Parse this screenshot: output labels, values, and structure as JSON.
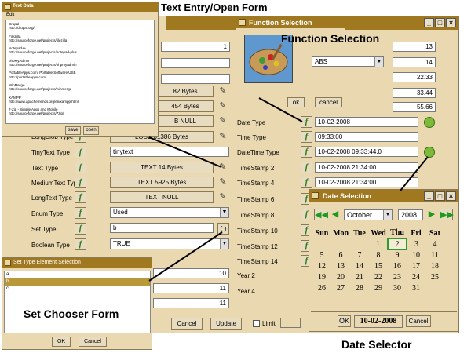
{
  "captions": {
    "text_entry": "Text Entry/Open Form",
    "function_selection": "Function Selection",
    "set_chooser": "Set Chooser Form",
    "date_selector": "Date Selector"
  },
  "text_window": {
    "title": "Text Data",
    "menu": "Edit",
    "lines": [
      "Drupal",
      "http://drupal.org/",
      "",
      "FileZilla",
      "http://sourceforge.net/projects/filezilla",
      "",
      "Notepad++",
      "http://sourceforge.net/projects/notepad-plus",
      "",
      "phpMyAdmin",
      "http://sourceforge.net/projects/phpmyadmin",
      "",
      "PortableApps.com: Portable Software/USB",
      "http://portableapps.com/",
      "",
      "WinMerge",
      "http://sourceforge.net/projects/winmerge",
      "",
      "XAMPP",
      "http://www.apachefriends.org/en/xampp.html",
      "",
      "7-Zip - Simple Apps and Mobile",
      "http://sourceforge.net/projects/7zip/"
    ],
    "save_label": "save",
    "open_label": "open"
  },
  "main_form": {
    "rows": [
      {
        "label": "",
        "value": "1"
      },
      {
        "label": "",
        "value": ""
      },
      {
        "label": "",
        "value": ""
      },
      {
        "label": "",
        "value": ""
      },
      {
        "label": "",
        "value": "82 Bytes"
      },
      {
        "label": "",
        "value": "454 Bytes"
      },
      {
        "label": "",
        "value": "B NULL"
      },
      {
        "label": "LongBlob Type",
        "value": "LOBB 61386 Bytes"
      },
      {
        "label": "TinyText Type",
        "value": "tinytext"
      },
      {
        "label": "Text Type",
        "value": "TEXT 14 Bytes"
      },
      {
        "label": "MediumText Type",
        "value": "TEXT 5925 Bytes"
      },
      {
        "label": "LongText Type",
        "value": "TEXT NULL"
      },
      {
        "label": "Enum Type",
        "value": "Used"
      },
      {
        "label": "Set Type",
        "value": "b"
      },
      {
        "label": "Boolean Type",
        "value": "TRUE"
      }
    ],
    "right_labels": [
      "Date Type",
      "Time Type",
      "DateTime Type",
      "TimeStamp 2",
      "TimeStamp 4",
      "TimeStamp 6",
      "TimeStamp 8",
      "TimeStamp 10",
      "TimeStamp 12",
      "TimeStamp 14",
      "Year 2",
      "Year 4"
    ],
    "right_values": [
      "10-02-2008",
      "09:33:00",
      "10-02-2008 09:33:44.0",
      "10-02-2008 21:34:00",
      "10-02-2008 21:34:00"
    ],
    "top_right_values": [
      "13",
      "14",
      "22.33",
      "33.44",
      "55.66"
    ],
    "lower_left_values": [
      "10",
      "11",
      "11"
    ],
    "set_dots": "( )",
    "cancel_label": "Cancel",
    "update_label": "Update",
    "limit_label": "Limit"
  },
  "function_dialog": {
    "title": "Function Selection",
    "selected": "ABS",
    "ok_label": "ok",
    "cancel_label": "cancel"
  },
  "set_dialog": {
    "title": "Set Type Element Selection",
    "items": [
      "a",
      "b",
      "c"
    ],
    "selected_index": 1,
    "ok_label": "OK",
    "cancel_label": "Cancel"
  },
  "date_dialog": {
    "title": "Date Selection",
    "month": "October",
    "year": "2008",
    "weekdays": [
      "Sun",
      "Mon",
      "Tue",
      "Wed",
      "Thu",
      "Fri",
      "Sat"
    ],
    "weeks": [
      [
        "",
        "",
        "",
        "1",
        "2",
        "3",
        "4"
      ],
      [
        "5",
        "6",
        "7",
        "8",
        "9",
        "10",
        "11"
      ],
      [
        "12",
        "13",
        "14",
        "15",
        "16",
        "17",
        "18"
      ],
      [
        "19",
        "20",
        "21",
        "22",
        "23",
        "24",
        "25"
      ],
      [
        "26",
        "27",
        "28",
        "29",
        "30",
        "31",
        ""
      ]
    ],
    "selected_day": "2",
    "ok_label": "OK",
    "date_value": "10-02-2008",
    "cancel_label": "Cancel"
  },
  "colors": {
    "title_bar": "#a07820",
    "panel": "#ead9b0",
    "accent_green": "#2f7a1f",
    "selection": "#b89838"
  }
}
